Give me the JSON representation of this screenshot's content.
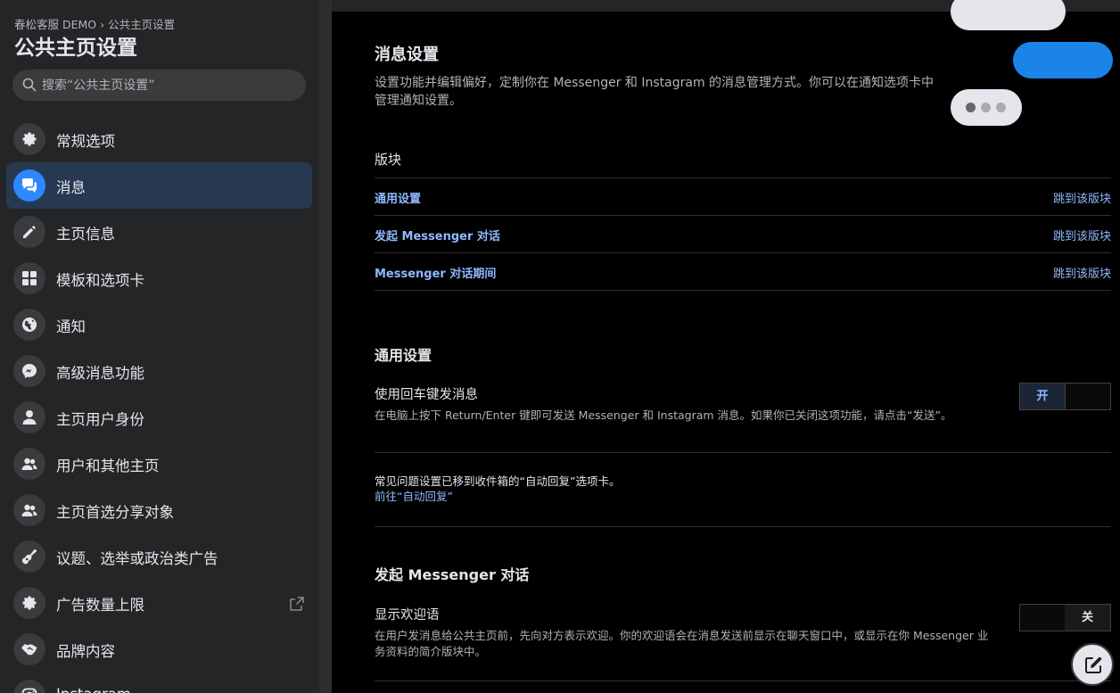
{
  "sidebar": {
    "breadcrumb": "春松客服 DEMO › 公共主页设置",
    "title": "公共主页设置",
    "search_placeholder": "搜索“公共主页设置”",
    "items": [
      {
        "label": "常规选项",
        "icon": "gear-icon"
      },
      {
        "label": "消息",
        "icon": "chat-bubbles-icon",
        "active": true
      },
      {
        "label": "主页信息",
        "icon": "pencil-icon"
      },
      {
        "label": "模板和选项卡",
        "icon": "grid-icon"
      },
      {
        "label": "通知",
        "icon": "globe-icon"
      },
      {
        "label": "高级消息功能",
        "icon": "messenger-icon"
      },
      {
        "label": "主页用户身份",
        "icon": "person-icon"
      },
      {
        "label": "用户和其他主页",
        "icon": "people-icon"
      },
      {
        "label": "主页首选分享对象",
        "icon": "people-icon"
      },
      {
        "label": "议题、选举或政治类广告",
        "icon": "guitar-icon"
      },
      {
        "label": "广告数量上限",
        "icon": "gear-icon",
        "external": true
      },
      {
        "label": "品牌内容",
        "icon": "handshake-icon"
      },
      {
        "label": "Instagram",
        "icon": "instagram-icon"
      }
    ]
  },
  "main": {
    "heading": "消息设置",
    "description": "设置功能并编辑偏好，定制你在 Messenger 和 Instagram 的消息管理方式。你可以在通知选项卡中管理通知设置。",
    "sections_title": "版块",
    "jump_label": "跳到该版块",
    "sections": [
      "通用设置",
      "发起 Messenger 对话",
      "Messenger 对话期间"
    ],
    "general": {
      "title": "通用设置",
      "enter_send": {
        "label": "使用回车键发消息",
        "description": "在电脑上按下 Return/Enter 键即可发送 Messenger 和 Instagram 消息。如果你已关闭这项功能，请点击“发送”。",
        "state": "开"
      },
      "faq_notice": "常见问题设置已移到收件箱的“自动回复”选项卡。",
      "faq_link": "前往“自动回复”"
    },
    "start_conversation": {
      "title": "发起 Messenger 对话",
      "greeting": {
        "label": "显示欢迎语",
        "description": "在用户发消息给公共主页前，先向对方表示欢迎。你的欢迎语会在消息发送前显示在聊天窗口中，或显示在你 Messenger 业务资料的简介版块中。",
        "state": "关"
      }
    }
  },
  "colors": {
    "accent": "#2d88ff",
    "link": "#8fb8ff",
    "active_bg": "#263951"
  }
}
